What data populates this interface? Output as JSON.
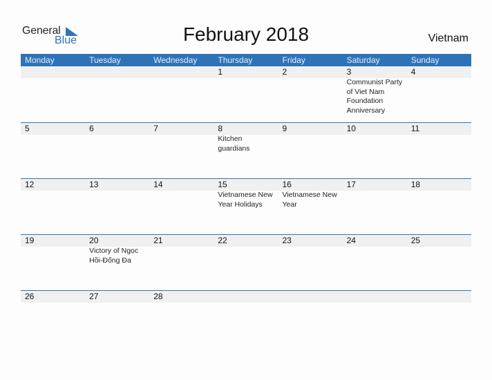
{
  "logo": {
    "general": "General",
    "blue": "Blue"
  },
  "title": "February 2018",
  "country": "Vietnam",
  "colors": {
    "accent": "#2e73b8",
    "strip": "#f0f0f0"
  },
  "weekdays": [
    "Monday",
    "Tuesday",
    "Wednesday",
    "Thursday",
    "Friday",
    "Saturday",
    "Sunday"
  ],
  "weeks": [
    [
      {
        "day": "",
        "event": ""
      },
      {
        "day": "",
        "event": ""
      },
      {
        "day": "",
        "event": ""
      },
      {
        "day": "1",
        "event": ""
      },
      {
        "day": "2",
        "event": ""
      },
      {
        "day": "3",
        "event": "Communist Party of Viet Nam Foundation Anniversary"
      },
      {
        "day": "4",
        "event": ""
      }
    ],
    [
      {
        "day": "5",
        "event": ""
      },
      {
        "day": "6",
        "event": ""
      },
      {
        "day": "7",
        "event": ""
      },
      {
        "day": "8",
        "event": "Kitchen guardians"
      },
      {
        "day": "9",
        "event": ""
      },
      {
        "day": "10",
        "event": ""
      },
      {
        "day": "11",
        "event": ""
      }
    ],
    [
      {
        "day": "12",
        "event": ""
      },
      {
        "day": "13",
        "event": ""
      },
      {
        "day": "14",
        "event": ""
      },
      {
        "day": "15",
        "event": "Vietnamese New Year Holidays"
      },
      {
        "day": "16",
        "event": "Vietnamese New Year"
      },
      {
        "day": "17",
        "event": ""
      },
      {
        "day": "18",
        "event": ""
      }
    ],
    [
      {
        "day": "19",
        "event": ""
      },
      {
        "day": "20",
        "event": "Victory of Ngọc Hồi-Đống Đa"
      },
      {
        "day": "21",
        "event": ""
      },
      {
        "day": "22",
        "event": ""
      },
      {
        "day": "23",
        "event": ""
      },
      {
        "day": "24",
        "event": ""
      },
      {
        "day": "25",
        "event": ""
      }
    ],
    [
      {
        "day": "26",
        "event": ""
      },
      {
        "day": "27",
        "event": ""
      },
      {
        "day": "28",
        "event": ""
      },
      {
        "day": "",
        "event": ""
      },
      {
        "day": "",
        "event": ""
      },
      {
        "day": "",
        "event": ""
      },
      {
        "day": "",
        "event": ""
      }
    ]
  ]
}
